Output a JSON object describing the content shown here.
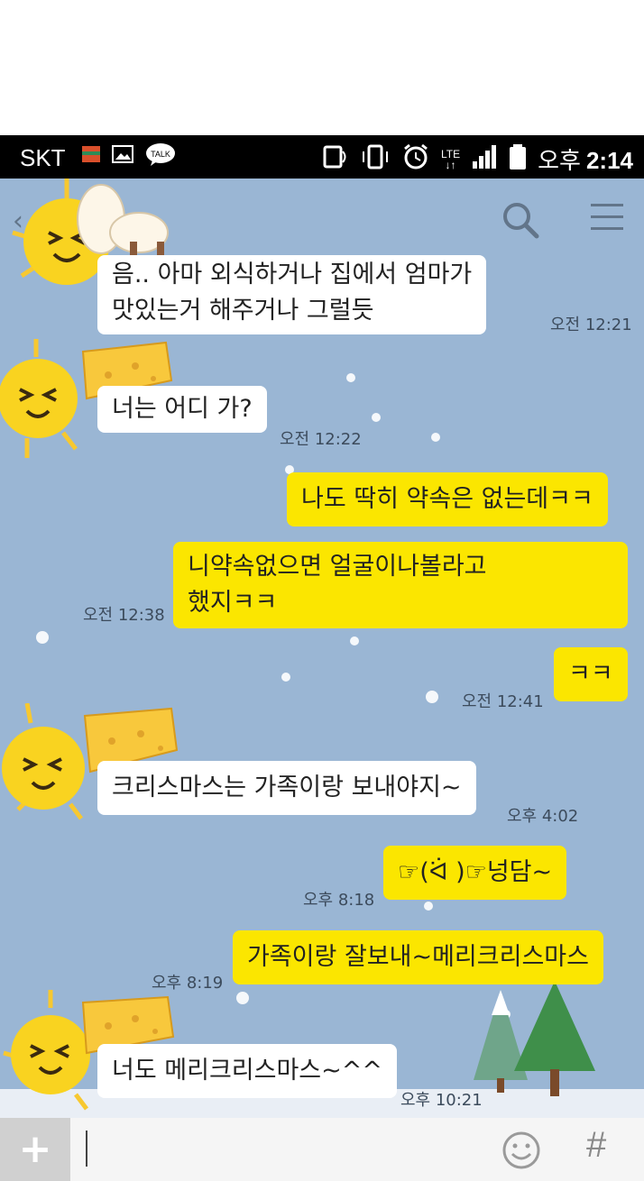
{
  "status_bar": {
    "carrier": "SKT",
    "network": "LTE",
    "time_ampm": "오후",
    "time": "2:14",
    "icons": [
      "notification-icon",
      "image-icon",
      "talk-icon",
      "nfc-icon",
      "vibrate-icon",
      "alarm-icon",
      "lte-icon",
      "signal-icon",
      "battery-icon"
    ]
  },
  "header": {
    "icons": [
      "back-icon",
      "search-icon",
      "menu-icon"
    ]
  },
  "messages": [
    {
      "side": "other",
      "text_lines": [
        "음.. 아마 외식하거나 집에서 엄마가",
        "맛있는거 해주거나 그럴듯"
      ],
      "time": "오전 12:21"
    },
    {
      "side": "other",
      "text_lines": [
        "너는 어디 가?"
      ],
      "time": "오전 12:22"
    },
    {
      "side": "me",
      "text_lines": [
        "나도 딱히 약속은 없는데ㅋㅋ"
      ],
      "time": ""
    },
    {
      "side": "me",
      "text_lines": [
        "니약속없으면 얼굴이나볼라고",
        "했지ㅋㅋ"
      ],
      "time": "오전 12:38"
    },
    {
      "side": "me",
      "text_lines": [
        "ㅋㅋ"
      ],
      "time": "오전 12:41"
    },
    {
      "side": "other",
      "text_lines": [
        "크리스마스는 가족이랑 보내야지~"
      ],
      "time": "오후 4:02"
    },
    {
      "side": "me",
      "text_lines": [
        "☞(ᐛ )☞넝담~"
      ],
      "time": "오후 8:18"
    },
    {
      "side": "me",
      "text_lines": [
        "가족이랑 잘보내~메리크리스마스"
      ],
      "time": "오후 8:19"
    },
    {
      "side": "other",
      "text_lines": [
        "너도 메리크리스마스~^^"
      ],
      "time": "오후 10:21"
    }
  ],
  "input_bar": {
    "plus_label": "+",
    "placeholder": "",
    "value": "",
    "hash_label": "#",
    "icons": [
      "plus-icon",
      "emoji-icon",
      "hash-icon"
    ]
  },
  "colors": {
    "chat_background": "#9ab6d4",
    "my_bubble": "#fbe600",
    "other_bubble": "#ffffff",
    "status_bar": "#000000"
  }
}
